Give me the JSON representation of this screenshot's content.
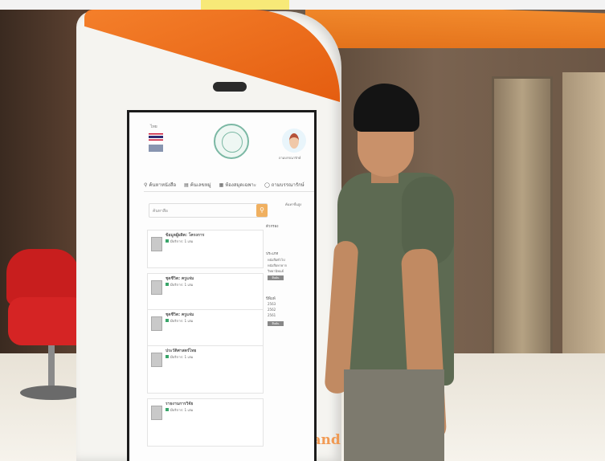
{
  "photo": {
    "kiosk_brand_text": "of Thailand",
    "screen": {
      "language_label": "ไทย",
      "avatar_label": "ถามบรรณารักษ์",
      "tabs": [
        {
          "label": "ค้นหาหนังสือ"
        },
        {
          "label": "ค้นเลขหมู่"
        },
        {
          "label": "ห้องสมุดเฉพาะ"
        },
        {
          "label": "ถามบรรณารักษ์"
        }
      ],
      "search_placeholder": "ค้นหาสือ",
      "advanced_search": "ค้นหาขั้นสูง",
      "sidebar": {
        "filter_heading": "ตัวกรอง",
        "type_heading": "ประเภท",
        "type_items": [
          "หนังสือทั่วไป",
          "หนังสือหายาก",
          "วิทยานิพนธ์"
        ],
        "year_heading": "ปีพิมพ์",
        "year_items": [
          "2563",
          "2562",
          "2561"
        ],
        "apply_label": "ยืนยัน"
      },
      "results": [
        {
          "title": "ข้อมูลผู้ผลิต: โครงการ",
          "meta": "มีบริการ: 1 เล่ม"
        },
        {
          "title": "ชุดชีวิต: ครูแจ่ม",
          "meta": "มีบริการ: 1 เล่ม"
        },
        {
          "title": "ชุดชีวิต: ครูแจ่ม",
          "meta": "มีบริการ: 1 เล่ม"
        },
        {
          "title": "ประวัติศาสตร์ไทย",
          "meta": "มีบริการ: 1 เล่ม"
        },
        {
          "title": "รายงานการวิจัย",
          "meta": "มีบริการ: 1 เล่ม"
        }
      ]
    }
  }
}
